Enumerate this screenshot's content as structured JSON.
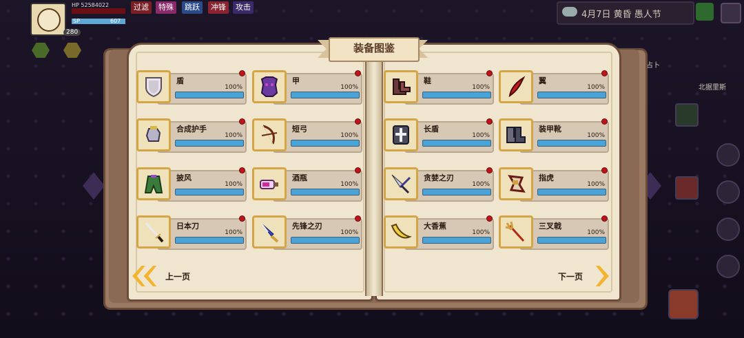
{
  "hud": {
    "hp_label": "HP",
    "hp_value": "52584022",
    "sp_label": "SP",
    "sp_value": "607",
    "level": "280",
    "tags": [
      "过滤",
      "特殊",
      "跳跃",
      "冲锋",
      "攻击"
    ],
    "date": "4月7日 黄昏 愚人节",
    "region_label": "北据里斯",
    "side_label": "占卜"
  },
  "book": {
    "title": "装备图鉴",
    "prev_label": "上一页",
    "next_label": "下一页",
    "left_cards": [
      {
        "name": "盾",
        "pct": "100%",
        "progress": 1.0
      },
      {
        "name": "甲",
        "pct": "100%",
        "progress": 1.0
      },
      {
        "name": "合成护手",
        "pct": "100%",
        "progress": 1.0
      },
      {
        "name": "短弓",
        "pct": "100%",
        "progress": 1.0
      },
      {
        "name": "披风",
        "pct": "100%",
        "progress": 1.0
      },
      {
        "name": "酒瓶",
        "pct": "100%",
        "progress": 1.0
      },
      {
        "name": "日本刀",
        "pct": "100%",
        "progress": 1.0
      },
      {
        "name": "先锋之刃",
        "pct": "100%",
        "progress": 1.0
      }
    ],
    "right_cards": [
      {
        "name": "鞋",
        "pct": "100%",
        "progress": 1.0
      },
      {
        "name": "翼",
        "pct": "100%",
        "progress": 1.0
      },
      {
        "name": "长盾",
        "pct": "100%",
        "progress": 1.0
      },
      {
        "name": "装甲靴",
        "pct": "100%",
        "progress": 1.0
      },
      {
        "name": "贪婪之刃",
        "pct": "100%",
        "progress": 1.0
      },
      {
        "name": "指虎",
        "pct": "100%",
        "progress": 1.0
      },
      {
        "name": "大香蕉",
        "pct": "100%",
        "progress": 1.0
      },
      {
        "name": "三叉戟",
        "pct": "100%",
        "progress": 1.0
      }
    ]
  },
  "colors": {
    "accent": "#f2b533",
    "bar_fill": "#4aa3d6",
    "new_dot": "#c0141a"
  }
}
